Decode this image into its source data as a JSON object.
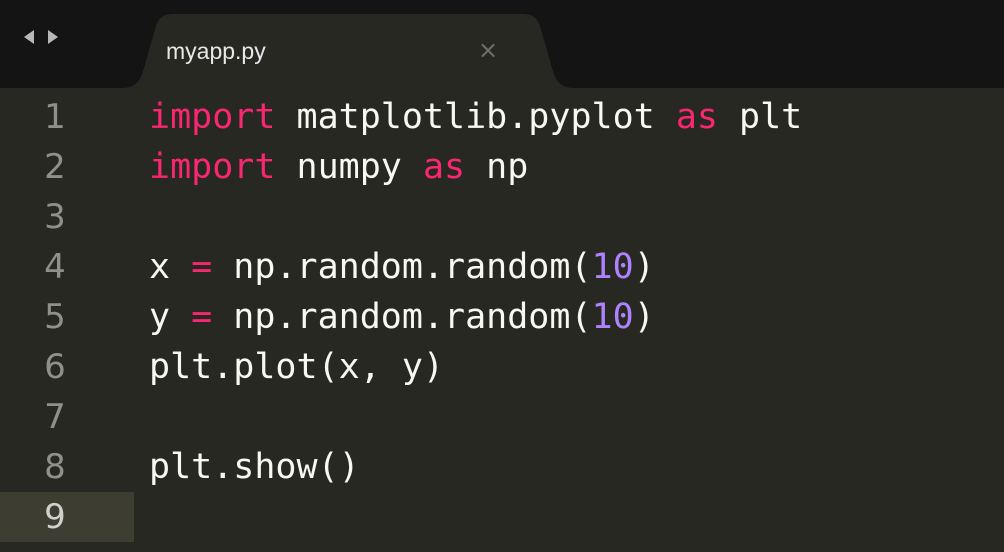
{
  "tab": {
    "title": "myapp.py",
    "close_glyph": "×"
  },
  "nav": {
    "back_icon": "triangle-left-icon",
    "forward_icon": "triangle-right-icon"
  },
  "colors": {
    "background": "#272822",
    "tabbar": "#141414",
    "keyword": "#f92672",
    "number": "#ae81ff",
    "text": "#f8f8f2",
    "gutter_text": "#8f908a",
    "active_line": "#3e3d32"
  },
  "editor": {
    "active_line": 9,
    "lines": [
      {
        "num": "1",
        "tokens": [
          {
            "t": "import",
            "c": "kw"
          },
          {
            "t": " matplotlib.pyplot ",
            "c": ""
          },
          {
            "t": "as",
            "c": "kw"
          },
          {
            "t": " plt",
            "c": ""
          }
        ]
      },
      {
        "num": "2",
        "tokens": [
          {
            "t": "import",
            "c": "kw"
          },
          {
            "t": " numpy ",
            "c": ""
          },
          {
            "t": "as",
            "c": "kw"
          },
          {
            "t": " np",
            "c": ""
          }
        ]
      },
      {
        "num": "3",
        "tokens": []
      },
      {
        "num": "4",
        "tokens": [
          {
            "t": "x ",
            "c": ""
          },
          {
            "t": "=",
            "c": "kw"
          },
          {
            "t": " np.random.random(",
            "c": ""
          },
          {
            "t": "10",
            "c": "num"
          },
          {
            "t": ")",
            "c": ""
          }
        ]
      },
      {
        "num": "5",
        "tokens": [
          {
            "t": "y ",
            "c": ""
          },
          {
            "t": "=",
            "c": "kw"
          },
          {
            "t": " np.random.random(",
            "c": ""
          },
          {
            "t": "10",
            "c": "num"
          },
          {
            "t": ")",
            "c": ""
          }
        ]
      },
      {
        "num": "6",
        "tokens": [
          {
            "t": "plt.plot(x, y)",
            "c": ""
          }
        ]
      },
      {
        "num": "7",
        "tokens": []
      },
      {
        "num": "8",
        "tokens": [
          {
            "t": "plt.show()",
            "c": ""
          }
        ]
      },
      {
        "num": "9",
        "tokens": []
      }
    ]
  }
}
